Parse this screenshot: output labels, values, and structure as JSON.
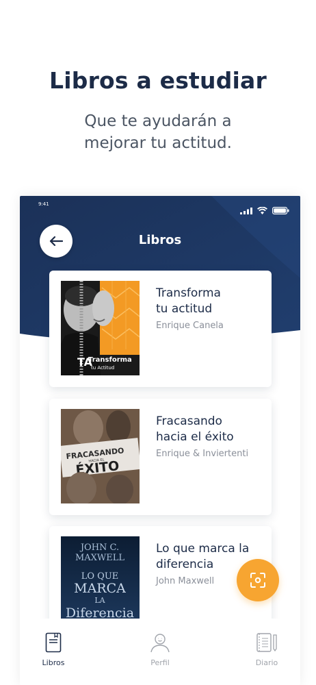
{
  "promo": {
    "headline": "Libros a estudiar",
    "subline_1": "Que te ayudarán a",
    "subline_2": "mejorar tu actitud."
  },
  "status_bar": {
    "time": "9:41"
  },
  "header": {
    "title": "Libros"
  },
  "books": [
    {
      "title_line1": "Transforma",
      "title_line2": "tu actitud",
      "author": "Enrique Canela",
      "cover": {
        "brand": "Transforma",
        "brand2": "tu Actitud"
      }
    },
    {
      "title_line1": "Fracasando",
      "title_line2": "hacia el éxito",
      "author": "Enrique & Inviertenti",
      "cover": {
        "word1": "FRACASANDO",
        "word2": "HACIA EL",
        "word3": "ÉXITO"
      }
    },
    {
      "title_line1": "Lo que marca la",
      "title_line2": "diferencia",
      "author": "John Maxwell",
      "cover": {
        "author": "JOHN C.",
        "author2": "MAXWELL",
        "t1": "LO QUE",
        "t2": "MARCA",
        "t3": "LA",
        "t4": "Diferencia"
      }
    }
  ],
  "tabs": [
    {
      "label": "Libros",
      "active": true
    },
    {
      "label": "Perfil",
      "active": false
    },
    {
      "label": "Diario",
      "active": false
    }
  ],
  "colors": {
    "navy": "#1c3560",
    "accent": "#f7a531",
    "active_tab": "#1c2b47",
    "inactive_tab": "#a0a4ab"
  },
  "icons": {
    "back": "arrow-left-icon",
    "scan": "scan-icon",
    "tab_libros": "notebook-icon",
    "tab_perfil": "user-icon",
    "tab_diario": "journal-icon"
  }
}
